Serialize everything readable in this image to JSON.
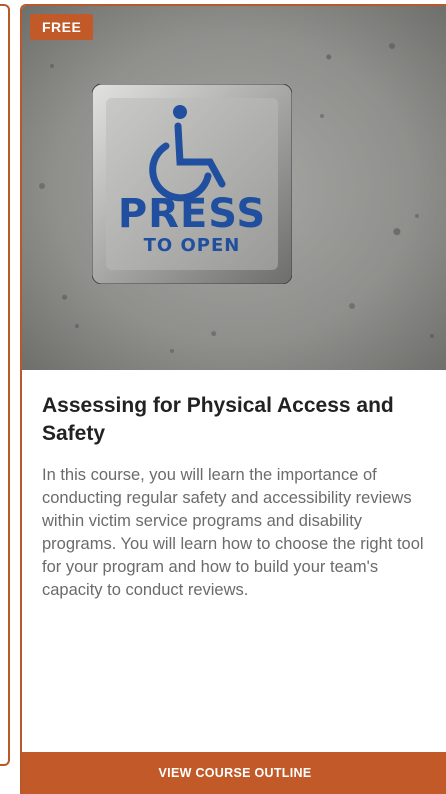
{
  "card": {
    "badge": "FREE",
    "image": {
      "sign_line_1": "PRESS",
      "sign_line_2": "TO OPEN",
      "icon": "wheelchair-icon"
    },
    "title": "Assessing for Physical Access and Safety",
    "description": "In this course, you will learn the importance of conducting regular safety and accessibility reviews within victim service programs and disability programs. You will learn how to choose the right tool for your program and how to build your team's capacity to conduct reviews.",
    "cta_label": "VIEW COURSE OUTLINE"
  },
  "colors": {
    "accent": "#c15a28",
    "border": "#b8592b",
    "sign_blue": "#1f4f9e"
  }
}
